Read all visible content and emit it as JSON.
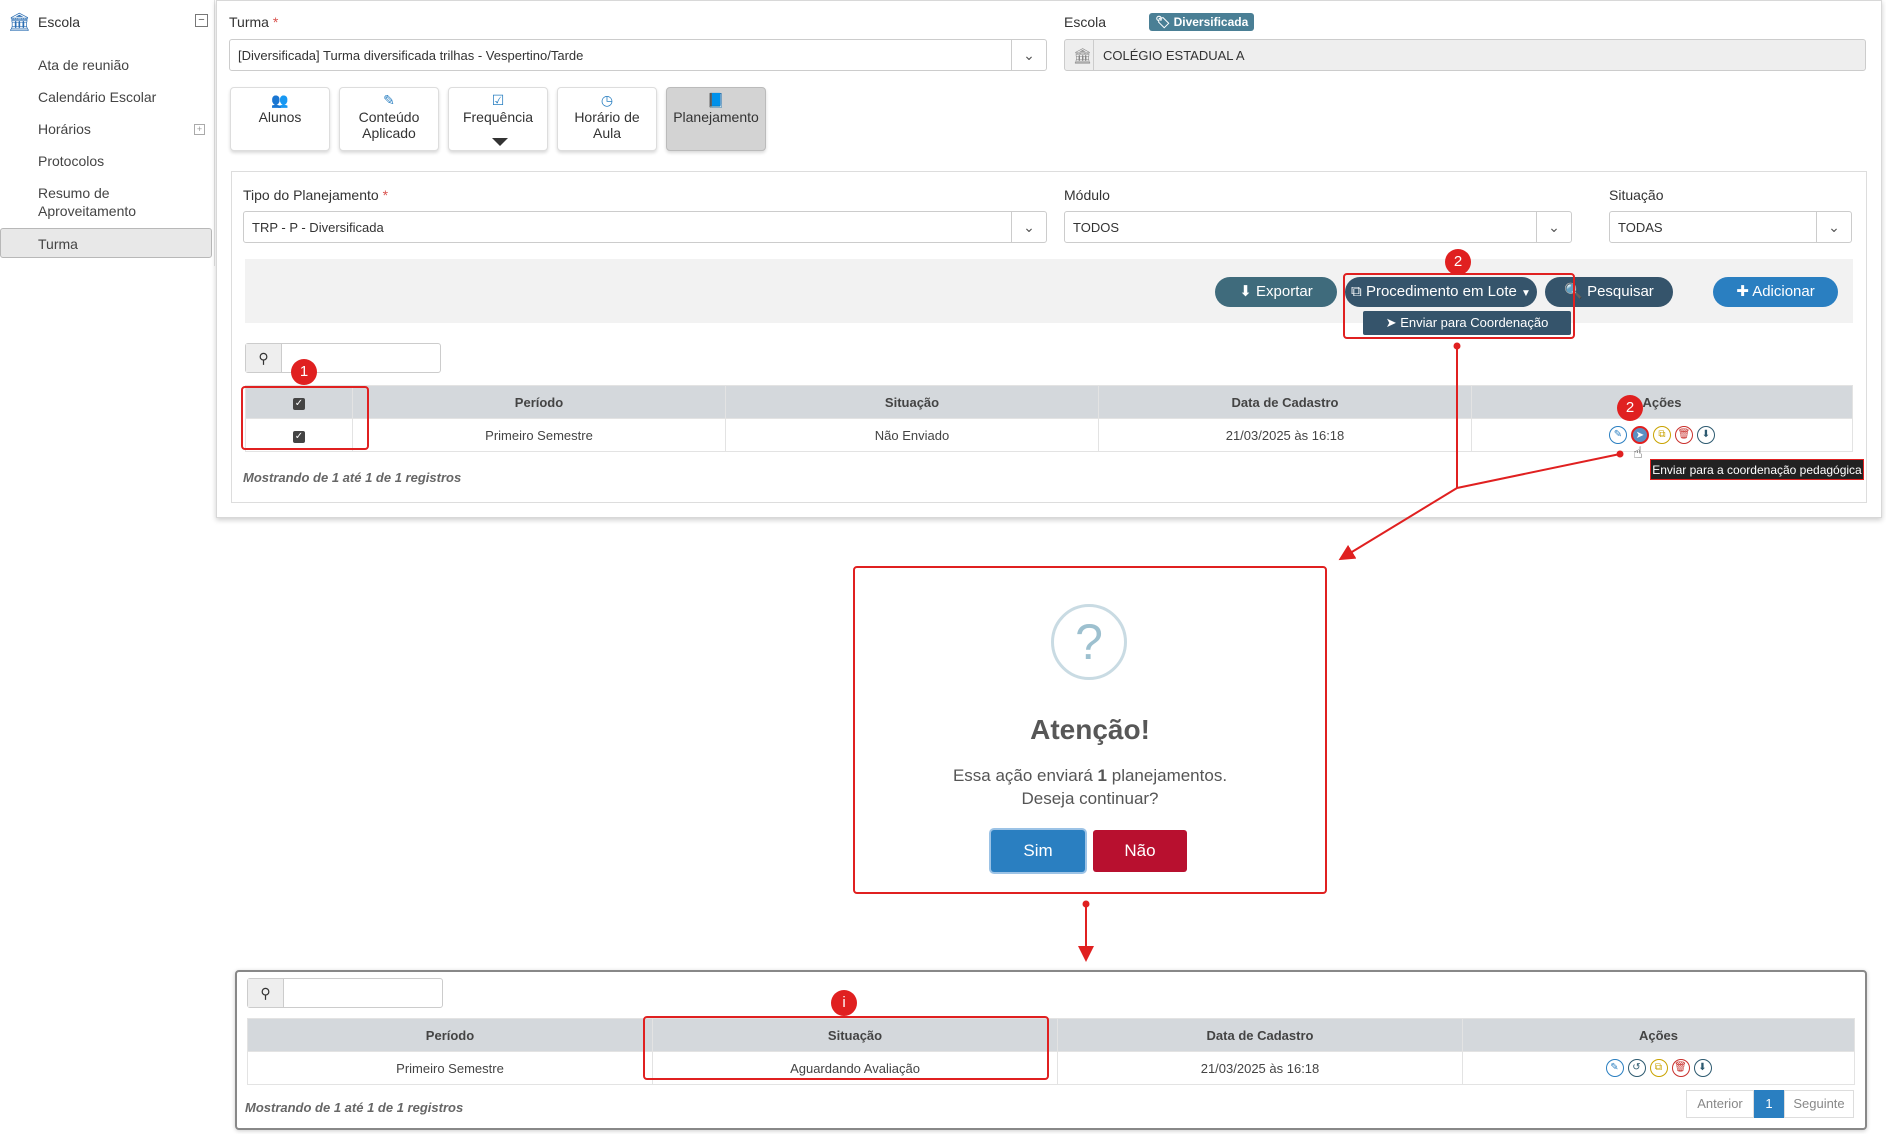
{
  "sidebar": {
    "header": "Escola",
    "items": [
      "Ata de reunião",
      "Calendário Escolar",
      "Horários",
      "Protocolos",
      "Resumo de",
      "Aproveitamento",
      "Turma"
    ]
  },
  "form": {
    "turma_label": "Turma",
    "required_mark": "*",
    "turma_badge": "Diversificada",
    "turma_value": "[Diversificada]  Turma diversificada trilhas - Vespertino/Tarde",
    "escola_label": "Escola",
    "escola_value": "COLÉGIO ESTADUAL A"
  },
  "tabs": [
    {
      "line1": "Alunos",
      "line2": ""
    },
    {
      "line1": "Conteúdo",
      "line2": "Aplicado"
    },
    {
      "line1": "Frequência",
      "line2": ""
    },
    {
      "line1": "Horário de",
      "line2": "Aula"
    },
    {
      "line1": "Planejamento",
      "line2": ""
    }
  ],
  "filters": {
    "tipo_label": "Tipo do Planejamento",
    "tipo_value": "TRP - P - Diversificada",
    "modulo_label": "Módulo",
    "modulo_value": "TODOS",
    "situacao_label": "Situação",
    "situacao_value": "TODAS"
  },
  "actions": {
    "exportar": "Exportar",
    "procedimento": "Procedimento em Lote",
    "enviar_coord": "Enviar para Coordenação",
    "pesquisar": "Pesquisar",
    "adicionar": "Adicionar"
  },
  "table": {
    "columns": [
      "Período",
      "Situação",
      "Data de Cadastro",
      "Ações"
    ],
    "rows": [
      {
        "periodo": "Primeiro Semestre",
        "situacao": "Não Enviado",
        "data": "21/03/2025 às 16:18"
      }
    ],
    "footer": "Mostrando de 1 até 1 de 1 registros",
    "tooltip": "Enviar para a coordenação pedagógica"
  },
  "markers": {
    "m1": "1",
    "m2": "2",
    "mi": "i"
  },
  "modal": {
    "symbol": "?",
    "title": "Atenção!",
    "text_pre": "Essa ação enviará ",
    "count": "1",
    "text_post": " planejamentos.",
    "question": "Deseja continuar?",
    "yes": "Sim",
    "no": "Não"
  },
  "result": {
    "columns": [
      "Período",
      "Situação",
      "Data de Cadastro",
      "Ações"
    ],
    "rows": [
      {
        "periodo": "Primeiro Semestre",
        "situacao": "Aguardando Avaliação",
        "data": "21/03/2025 às 16:18"
      }
    ],
    "footer": "Mostrando de 1 até 1 de 1 registros",
    "pager": {
      "prev": "Anterior",
      "current": "1",
      "next": "Seguinte"
    }
  },
  "colors": {
    "primary": "#2a7fc1",
    "danger": "#b8102f",
    "dark_pill": "#35546b",
    "annotation": "#e02020"
  }
}
